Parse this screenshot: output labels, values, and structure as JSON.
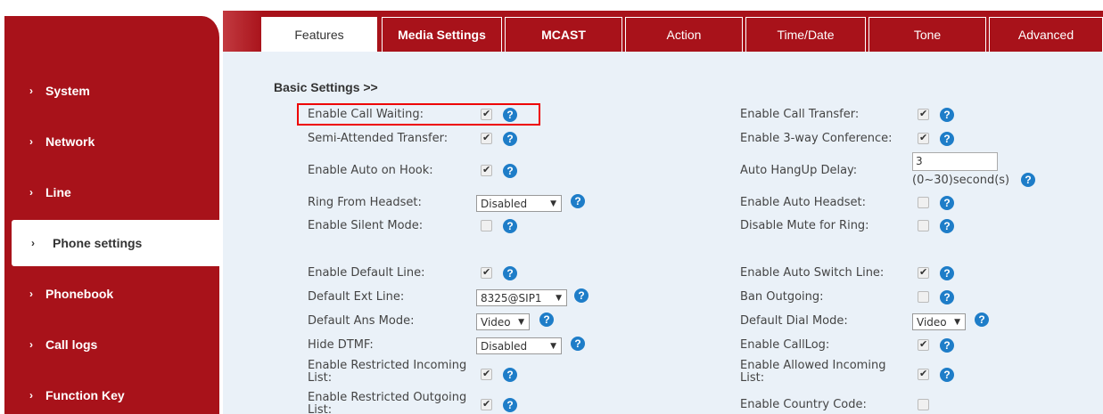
{
  "sidebar": {
    "items": [
      {
        "label": "System"
      },
      {
        "label": "Network"
      },
      {
        "label": "Line"
      },
      {
        "label": "Phone settings"
      },
      {
        "label": "Phonebook"
      },
      {
        "label": "Call logs"
      },
      {
        "label": "Function Key"
      }
    ],
    "chevron": "›"
  },
  "tabs": [
    {
      "label": "Features"
    },
    {
      "label": "Media Settings"
    },
    {
      "label": "MCAST"
    },
    {
      "label": "Action"
    },
    {
      "label": "Time/Date"
    },
    {
      "label": "Tone"
    },
    {
      "label": "Advanced"
    }
  ],
  "section": {
    "title": "Basic Settings >>"
  },
  "left_settings": {
    "call_waiting": {
      "label": "Enable Call Waiting:",
      "checked": true
    },
    "semi_attended": {
      "label": "Semi-Attended Transfer:",
      "checked": true
    },
    "auto_on_hook": {
      "label": "Enable Auto on Hook:",
      "checked": true
    },
    "ring_from_headset": {
      "label": "Ring From Headset:",
      "value": "Disabled"
    },
    "silent_mode": {
      "label": "Enable Silent Mode:",
      "checked": false
    },
    "default_line": {
      "label": "Enable Default Line:",
      "checked": true
    },
    "default_ext_line": {
      "label": "Default Ext Line:",
      "value": "8325@SIP1"
    },
    "default_ans_mode": {
      "label": "Default Ans Mode:",
      "value": "Video"
    },
    "hide_dtmf": {
      "label": "Hide DTMF:",
      "value": "Disabled"
    },
    "restricted_incoming": {
      "label_line1": "Enable Restricted Incoming",
      "label_line2": "List:",
      "checked": true
    },
    "restricted_outgoing": {
      "label_line1": "Enable Restricted Outgoing",
      "label_line2": "List:",
      "checked": true
    }
  },
  "right_settings": {
    "call_transfer": {
      "label": "Enable Call Transfer:",
      "checked": true
    },
    "three_way": {
      "label": "Enable 3-way Conference:",
      "checked": true
    },
    "auto_hangup_delay": {
      "label": "Auto HangUp Delay:",
      "value": "3",
      "hint": "(0~30)second(s)"
    },
    "auto_headset": {
      "label": "Enable Auto Headset:",
      "checked": false
    },
    "disable_mute_ring": {
      "label": "Disable Mute for Ring:",
      "checked": false
    },
    "auto_switch_line": {
      "label": "Enable Auto Switch Line:",
      "checked": true
    },
    "ban_outgoing": {
      "label": "Ban Outgoing:",
      "checked": false
    },
    "default_dial_mode": {
      "label": "Default Dial Mode:",
      "value": "Video"
    },
    "call_log": {
      "label": "Enable CallLog:",
      "checked": true
    },
    "allowed_incoming": {
      "label_line1": "Enable Allowed Incoming",
      "label_line2": "List:",
      "checked": true
    },
    "country_code": {
      "label": "Enable Country Code:",
      "checked": false
    }
  },
  "icons": {
    "help": "?",
    "dropdown_arrow": "▼"
  },
  "colors": {
    "brand_red": "#a8121a",
    "content_bg": "#eaf1f8",
    "help_blue": "#1e7dc8",
    "highlight": "#ee0000"
  }
}
